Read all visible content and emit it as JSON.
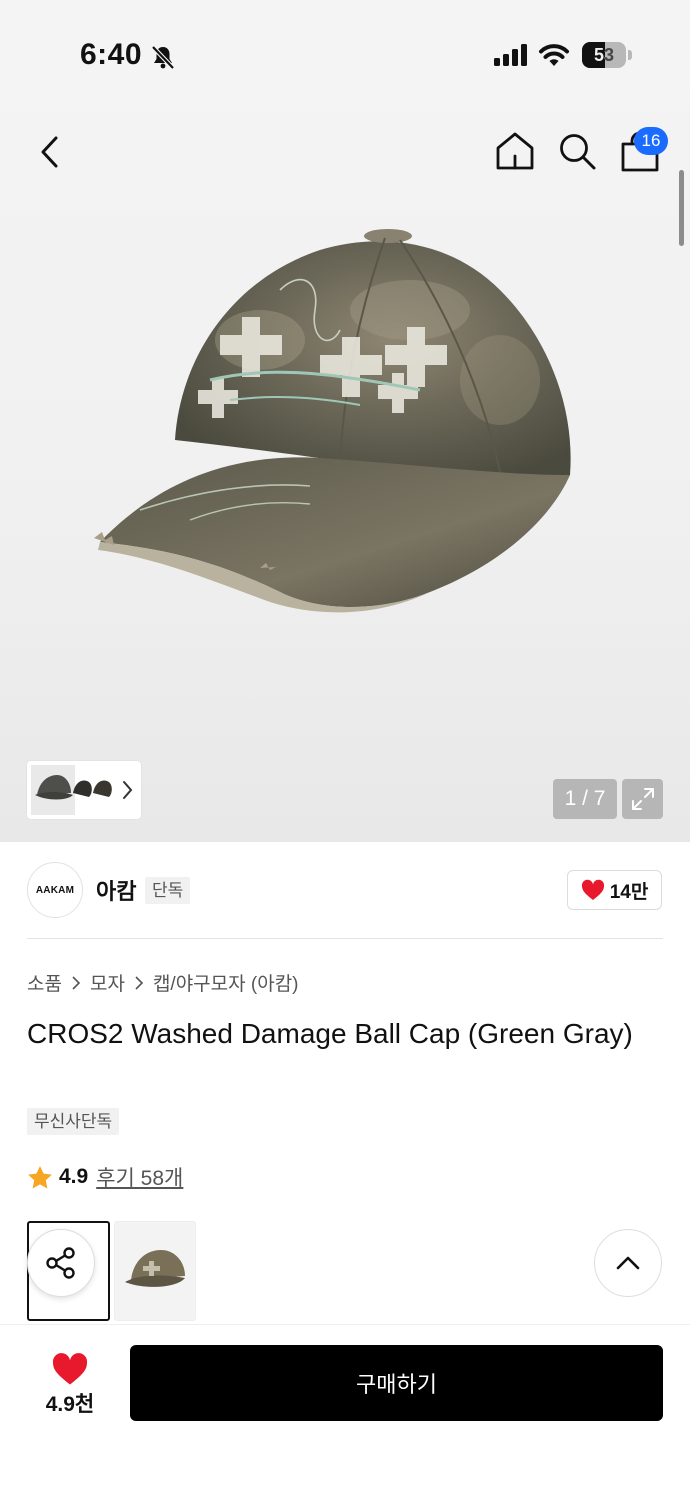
{
  "status_bar": {
    "time": "6:40",
    "battery": "53",
    "battery_level": 0.53,
    "icons": [
      "bell-slash-icon",
      "signal-icon",
      "wifi-icon",
      "battery-icon"
    ]
  },
  "header": {
    "cart_count": "16",
    "icons": [
      "back-icon",
      "home-icon",
      "search-icon",
      "cart-icon"
    ]
  },
  "gallery": {
    "counter": "1 / 7",
    "expand_icon": "expand-icon"
  },
  "brand": {
    "logo_text": "AAKAM",
    "name": "아캄",
    "tag": "단독",
    "like_count": "14만"
  },
  "breadcrumb": [
    "소품",
    "모자",
    "캡/야구모자 (아캄)"
  ],
  "product": {
    "title": "CROS2 Washed Damage Ball Cap (Green Gray)",
    "tag": "무신사단독",
    "rating": "4.9",
    "review_label": "후기 58개"
  },
  "bottom_bar": {
    "wish_count": "4.9천",
    "buy_label": "구매하기"
  },
  "colors": {
    "accent": "#1a6bff",
    "heart": "#e8192c",
    "star": "#f5a623",
    "buy_button": "#000000"
  }
}
